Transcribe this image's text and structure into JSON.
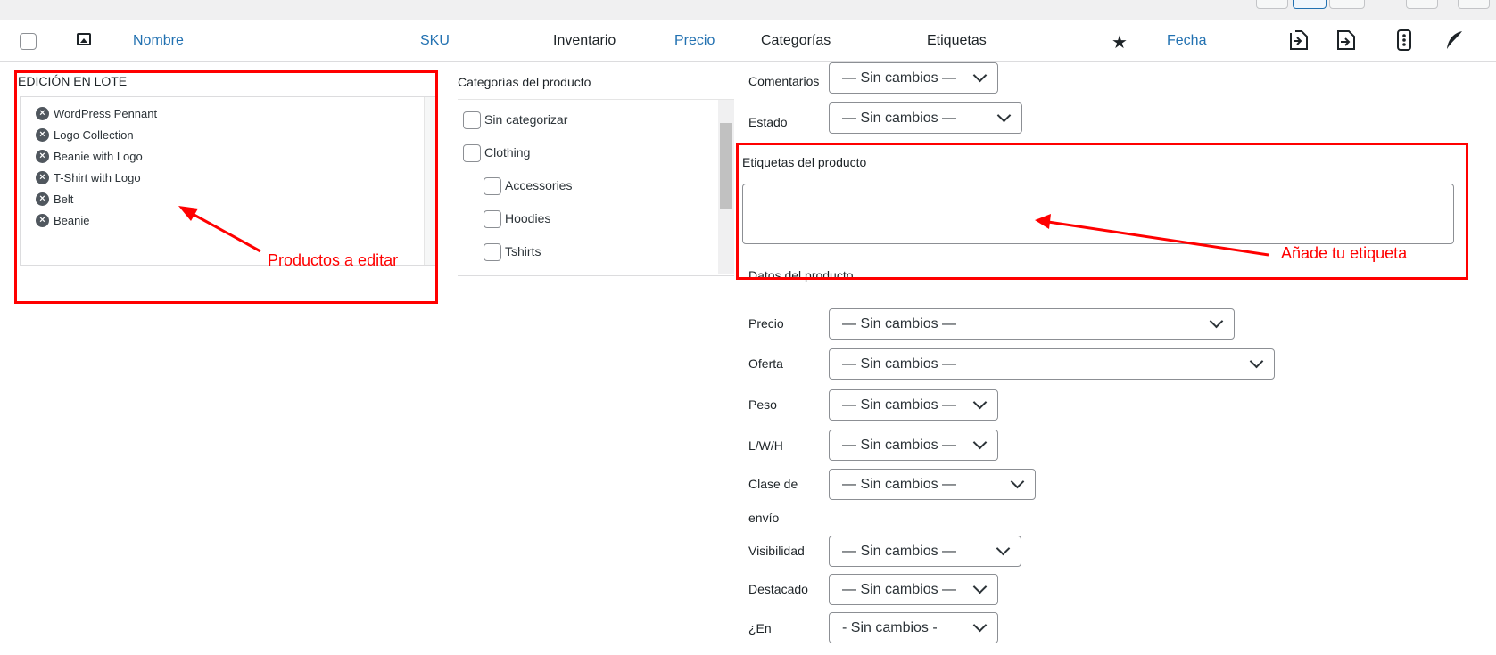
{
  "header": {
    "columns": {
      "nombre": "Nombre",
      "sku": "SKU",
      "inventario": "Inventario",
      "precio": "Precio",
      "categorias": "Categorías",
      "etiquetas": "Etiquetas",
      "fecha": "Fecha"
    },
    "icons": [
      "image-icon",
      "star-icon",
      "export-icon",
      "import-icon",
      "columns-icon",
      "feather-icon"
    ]
  },
  "bulk_edit": {
    "title": "EDICIÓN EN LOTE",
    "products": [
      "WordPress Pennant",
      "Logo Collection",
      "Beanie with Logo",
      "T-Shirt with Logo",
      "Belt",
      "Beanie"
    ]
  },
  "categories": {
    "title": "Categorías del producto",
    "items": [
      {
        "label": "Sin categorizar",
        "level": 0
      },
      {
        "label": "Clothing",
        "level": 0
      },
      {
        "label": "Accessories",
        "level": 1
      },
      {
        "label": "Hoodies",
        "level": 1
      },
      {
        "label": "Tshirts",
        "level": 1
      }
    ]
  },
  "fields": {
    "comentarios": {
      "label": "Comentarios",
      "value": "— Sin cambios —"
    },
    "estado": {
      "label": "Estado",
      "value": "— Sin cambios —"
    },
    "tags_label": "Etiquetas del producto",
    "datos_label": "Datos del producto",
    "precio": {
      "label": "Precio",
      "value": "— Sin cambios —"
    },
    "oferta": {
      "label": "Oferta",
      "value": "— Sin cambios —"
    },
    "peso": {
      "label": "Peso",
      "value": "— Sin cambios —"
    },
    "lwh": {
      "label": "L/W/H",
      "value": "— Sin cambios —"
    },
    "clase_envio": {
      "label_line1": "Clase de",
      "label_line2": "envío",
      "value": "— Sin cambios —"
    },
    "visibilidad": {
      "label": "Visibilidad",
      "value": "— Sin cambios —"
    },
    "destacado": {
      "label": "Destacado",
      "value": "— Sin cambios —"
    },
    "en_stock": {
      "label": "¿En",
      "value": "- Sin cambios -"
    }
  },
  "annotations": {
    "productos": "Productos a editar",
    "etiqueta": "Añade tu etiqueta"
  },
  "colors": {
    "annotation": "#ff0000",
    "link": "#2271b1"
  }
}
